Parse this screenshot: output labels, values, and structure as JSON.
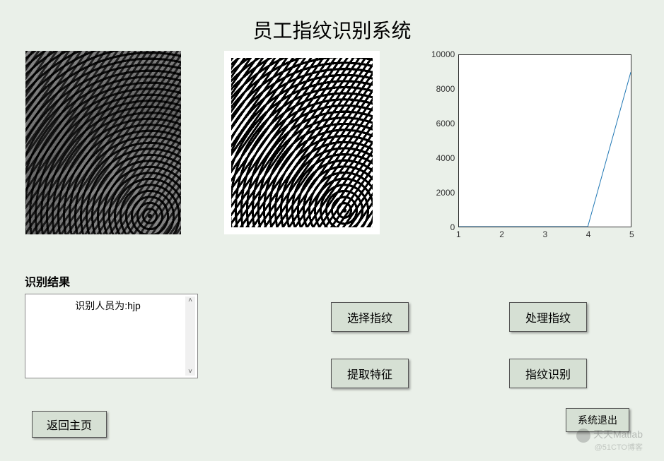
{
  "title": "员工指纹识别系统",
  "result": {
    "label": "识别结果",
    "text": "识别人员为:hjp"
  },
  "buttons": {
    "select": "选择指纹",
    "process": "处理指纹",
    "extract": "提取特征",
    "recognize": "指纹识别",
    "return": "返回主页",
    "exit": "系统退出"
  },
  "chart_data": {
    "type": "line",
    "x": [
      1,
      2,
      3,
      4,
      5
    ],
    "y": [
      0,
      0,
      0,
      0,
      9000
    ],
    "xlabel": "",
    "ylabel": "",
    "xlim": [
      1,
      5
    ],
    "ylim": [
      0,
      10000
    ],
    "xticks": [
      1,
      2,
      3,
      4,
      5
    ],
    "yticks": [
      0,
      2000,
      4000,
      6000,
      8000,
      10000
    ]
  },
  "watermark": {
    "main": "天天Matlab",
    "sub": "@51CTO博客"
  }
}
